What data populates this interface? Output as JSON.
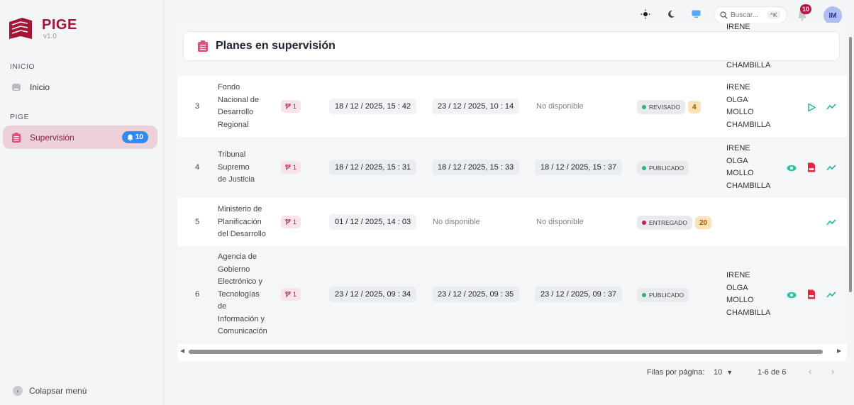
{
  "app": {
    "name": "PIGE",
    "version": "v1.0",
    "brand_color": "#a31535"
  },
  "sidebar": {
    "sections": [
      {
        "label": "INICIO",
        "items": [
          {
            "label": "Inicio",
            "icon": "home-icon"
          }
        ]
      },
      {
        "label": "PIGE",
        "items": [
          {
            "label": "Supervisión",
            "icon": "clipboard-list-icon",
            "active": true,
            "badge": "10"
          }
        ]
      }
    ],
    "collapse_label": "Colapsar menú"
  },
  "topbar": {
    "search_placeholder": "Buscar...",
    "search_shortcut": "^K",
    "notifications_count": "10",
    "avatar_initials": "IM",
    "icons": [
      "sun-icon",
      "moon-icon",
      "monitor-icon",
      "search-icon",
      "bell-icon"
    ]
  },
  "panel": {
    "title": "Planes en supervisión",
    "partial_top_row": {
      "person_last": "CHAMBILLA",
      "person_top_clipped": "IRENE"
    },
    "rows": [
      {
        "num": "3",
        "entity": [
          "Fondo",
          "Nacional de",
          "Desarrollo",
          "Regional"
        ],
        "branch": "1",
        "date1": {
          "d": "18",
          "m": "12",
          "y": "2025",
          "h": "15",
          "min": "42"
        },
        "date2": {
          "d": "23",
          "m": "12",
          "y": "2025",
          "h": "10",
          "min": "14"
        },
        "date3_text": "No disponible",
        "status": "REVISADO",
        "status_color": "#2bb673",
        "count": "4",
        "person": [
          "IRENE",
          "OLGA",
          "MOLLO",
          "CHAMBILLA"
        ],
        "actions": [
          "play-icon",
          "trend-icon"
        ]
      },
      {
        "num": "4",
        "entity": [
          "Tribunal",
          "Supremo",
          "de Justicia"
        ],
        "branch": "1",
        "date1": {
          "d": "18",
          "m": "12",
          "y": "2025",
          "h": "15",
          "min": "31"
        },
        "date2": {
          "d": "18",
          "m": "12",
          "y": "2025",
          "h": "15",
          "min": "33"
        },
        "date3": {
          "d": "18",
          "m": "12",
          "y": "2025",
          "h": "15",
          "min": "37"
        },
        "status": "PUBLICADO",
        "status_color": "#2bb673",
        "person": [
          "IRENE",
          "OLGA",
          "MOLLO",
          "CHAMBILLA"
        ],
        "actions": [
          "eye-icon",
          "pdf-icon",
          "trend-icon"
        ]
      },
      {
        "num": "5",
        "entity": [
          "Ministerio de",
          "Planificación",
          "del Desarrollo"
        ],
        "branch": "1",
        "date1": {
          "d": "01",
          "m": "12",
          "y": "2025",
          "h": "14",
          "min": "03"
        },
        "date2_text": "No disponible",
        "date3_text": "No disponible",
        "status": "ENTREGADO",
        "status_color": "#c2185b",
        "count": "20",
        "actions": [
          "trend-icon"
        ]
      },
      {
        "num": "6",
        "entity": [
          "Agencia de",
          "Gobierno",
          "Electrónico y",
          "Tecnologías",
          "de",
          "Información y",
          "Comunicación"
        ],
        "branch": "1",
        "date1": {
          "d": "23",
          "m": "12",
          "y": "2025",
          "h": "09",
          "min": "34"
        },
        "date2": {
          "d": "23",
          "m": "12",
          "y": "2025",
          "h": "09",
          "min": "35"
        },
        "date3": {
          "d": "23",
          "m": "12",
          "y": "2025",
          "h": "09",
          "min": "37"
        },
        "status": "PUBLICADO",
        "status_color": "#2bb673",
        "person": [
          "IRENE",
          "OLGA",
          "MOLLO",
          "CHAMBILLA"
        ],
        "actions": [
          "eye-icon",
          "pdf-icon",
          "trend-icon"
        ]
      }
    ]
  },
  "pagination": {
    "rows_per_page_label": "Filas por página:",
    "rows_per_page_value": "10",
    "range_label": "1-6 de 6"
  }
}
